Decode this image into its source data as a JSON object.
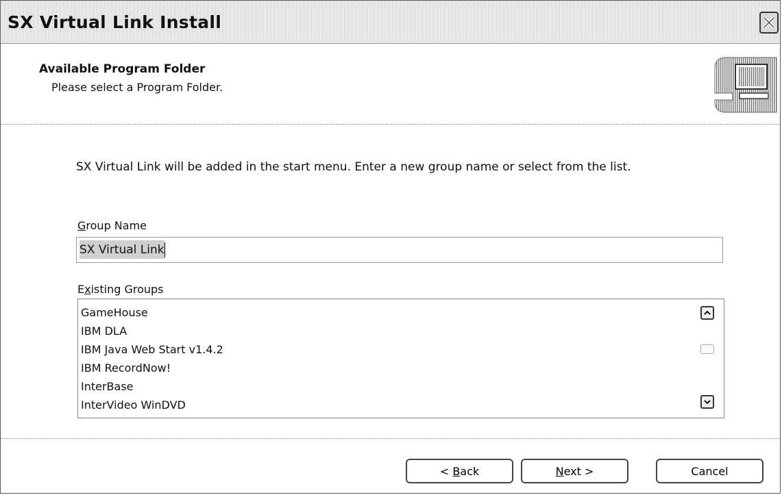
{
  "window": {
    "title": "SX Virtual Link Install",
    "close_icon": "close-icon"
  },
  "header": {
    "title": "Available Program Folder",
    "subtitle": "Please select a Program Folder.",
    "icon": "computer-icon"
  },
  "instruction": "SX Virtual Link will be added in the start menu. Enter a new group name  or select from the list.",
  "group_name": {
    "label": "Group Name",
    "mnemonic": "G",
    "label_rest": "roup Name",
    "value": "SX Virtual Link"
  },
  "existing_groups": {
    "label_pre": "E",
    "mnemonic": "x",
    "label_rest": "isting Groups",
    "items": [
      "GameHouse",
      "IBM DLA",
      "IBM Java Web Start v1.4.2",
      "IBM RecordNow!",
      "InterBase",
      "InterVideo WinDVD"
    ]
  },
  "buttons": {
    "back_prefix": "< ",
    "back_mnemonic": "B",
    "back_rest": "ack",
    "next_mnemonic": "N",
    "next_rest": "ext >",
    "cancel": "Cancel"
  },
  "colors": {
    "titlebar_pattern": "#cfcfcf",
    "selection": "#cfcfcf",
    "border": "#444444"
  }
}
